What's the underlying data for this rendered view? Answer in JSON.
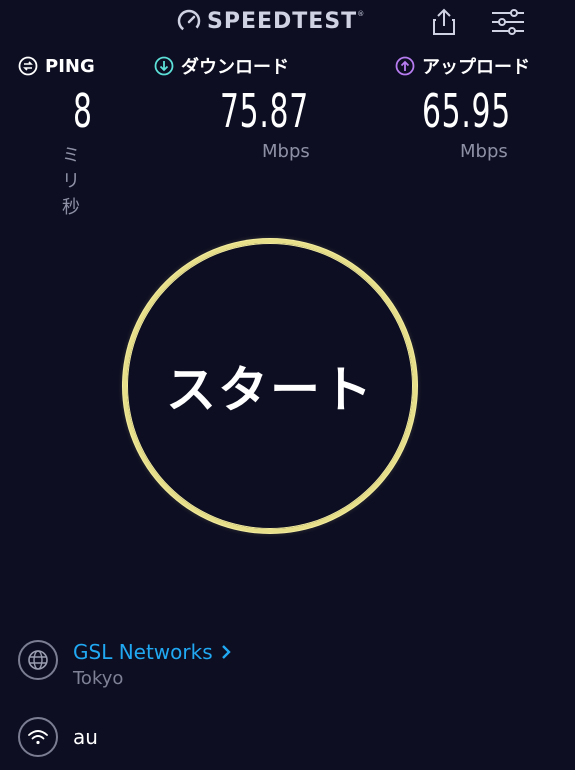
{
  "header": {
    "logo_text": "SPEEDTEST",
    "logo_mark": "®",
    "icons": [
      "speedometer-icon",
      "share-icon",
      "settings-sliders-icon"
    ]
  },
  "metrics": {
    "ping": {
      "label": "PING",
      "value": "8",
      "unit": "ミリ秒",
      "icon": "ping-icon"
    },
    "download": {
      "label": "ダウンロード",
      "value": "75.87",
      "unit": "Mbps",
      "icon": "download-arrow-icon"
    },
    "upload": {
      "label": "アップロード",
      "value": "65.95",
      "unit": "Mbps",
      "icon": "upload-arrow-icon"
    }
  },
  "start_button": {
    "label": "スタート"
  },
  "server": {
    "name": "GSL Networks",
    "location": "Tokyo",
    "icon": "globe-icon"
  },
  "network": {
    "name": "au",
    "icon": "wifi-icon"
  },
  "colors": {
    "background": "#0d0e22",
    "accent_ping": "#ffffff",
    "accent_download": "#5ce0d8",
    "accent_upload": "#b77cf0",
    "start_ring": "#e8df8a",
    "link": "#21a8f2",
    "muted": "#8e91a6"
  }
}
